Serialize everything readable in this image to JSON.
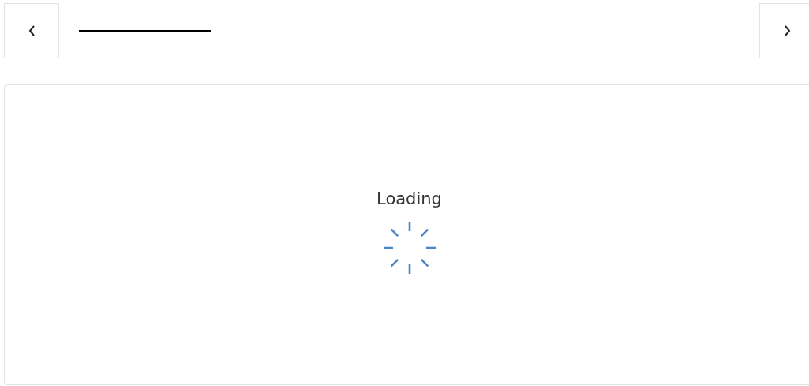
{
  "status": {
    "label": "Loading"
  }
}
